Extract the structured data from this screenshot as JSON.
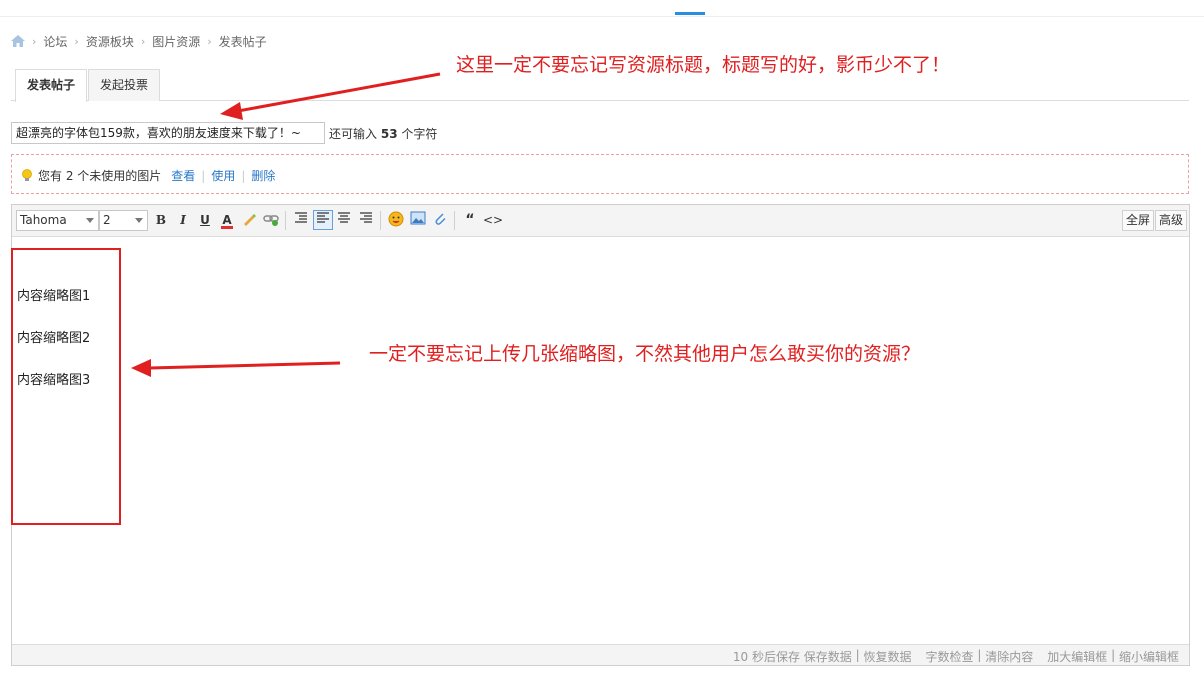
{
  "breadcrumb": {
    "home_icon": "home-icon",
    "separator": "›",
    "items": [
      "论坛",
      "资源板块",
      "图片资源",
      "发表帖子"
    ]
  },
  "tabs": [
    {
      "label": "发表帖子",
      "active": true
    },
    {
      "label": "发起投票",
      "active": false
    }
  ],
  "title_field": {
    "value": "超漂亮的字体包159款，喜欢的朋友速度来下载了！~",
    "remaining_prefix": "还可输入",
    "remaining_count": "53",
    "remaining_suffix": "个字符"
  },
  "notice": {
    "icon": "lightbulb-icon",
    "text": "您有 2 个未使用的图片",
    "links": [
      "查看",
      "使用",
      "删除"
    ]
  },
  "toolbar": {
    "font_family": "Tahoma",
    "font_size": "2",
    "bold": "B",
    "italic": "I",
    "underline": "U",
    "font_color": "A",
    "quote": "“",
    "code": "<>",
    "fullscreen": "全屏",
    "advanced": "高级"
  },
  "content": {
    "lines": [
      "内容缩略图1",
      "内容缩略图2",
      "内容缩略图3"
    ]
  },
  "statusbar": {
    "autosave": "10 秒后保存",
    "save_data": "保存数据",
    "restore_data": "恢复数据",
    "word_check": "字数检查",
    "clear_content": "清除内容",
    "enlarge": "加大编辑框",
    "shrink": "缩小编辑框",
    "divider": "|"
  },
  "annotations": {
    "title_tip": "这里一定不要忘记写资源标题，标题写的好，影币少不了！",
    "thumb_tip": "一定不要忘记上传几张缩略图，不然其他用户怎么敢买你的资源？"
  },
  "colors": {
    "annotation_red": "#e02020",
    "link_blue": "#2a78c8",
    "accent_blue": "#2a8ee0"
  }
}
